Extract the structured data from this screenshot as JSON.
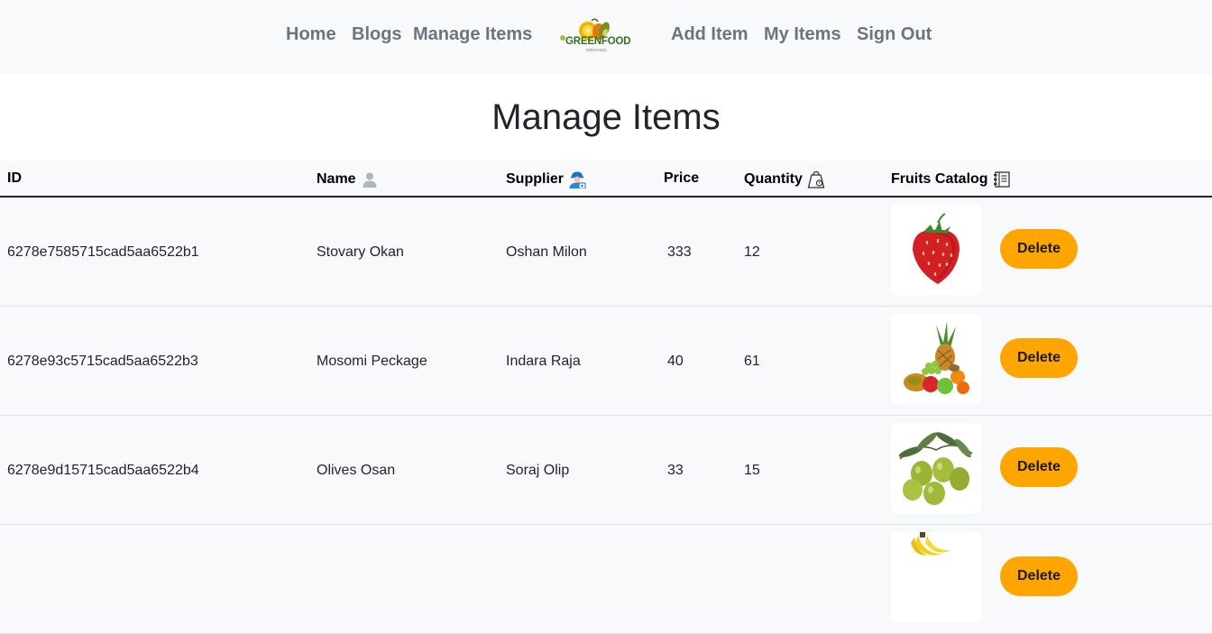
{
  "nav": {
    "home": "Home",
    "blogs": "Blogs",
    "manage_items": "Manage Items",
    "add_item": "Add Item",
    "my_items": "My Items",
    "sign_out": "Sign Out",
    "logo_text": "GREENFOOD",
    "logo_subtext": "ORGANIC"
  },
  "page": {
    "title": "Manage Items"
  },
  "table": {
    "headers": {
      "id": "ID",
      "name": "Name",
      "supplier": "Supplier",
      "price": "Price",
      "quantity": "Quantity",
      "catalog": "Fruits Catalog"
    },
    "header_icons": {
      "name": "person-icon",
      "supplier": "supplier-person-icon",
      "quantity": "weight-bag-icon",
      "catalog": "catalog-book-icon"
    },
    "delete_label": "Delete",
    "rows": [
      {
        "id": "6278e7585715cad5aa6522b1",
        "name": "Stovary Okan",
        "supplier": "Oshan Milon",
        "price": "333",
        "quantity": "12",
        "image": "strawberry"
      },
      {
        "id": "6278e93c5715cad5aa6522b3",
        "name": "Mosomi Peckage",
        "supplier": "Indara Raja",
        "price": "40",
        "quantity": "61",
        "image": "fruit-basket"
      },
      {
        "id": "6278e9d15715cad5aa6522b4",
        "name": "Olives Osan",
        "supplier": "Soraj Olip",
        "price": "33",
        "quantity": "15",
        "image": "olives"
      },
      {
        "id": "",
        "name": "",
        "supplier": "",
        "price": "",
        "quantity": "",
        "image": "bananas"
      }
    ]
  },
  "colors": {
    "nav_bg": "#f8f9fa",
    "nav_text": "#6c757d",
    "delete_button": "#ffa500",
    "row_bg": "#f8f9fa"
  }
}
